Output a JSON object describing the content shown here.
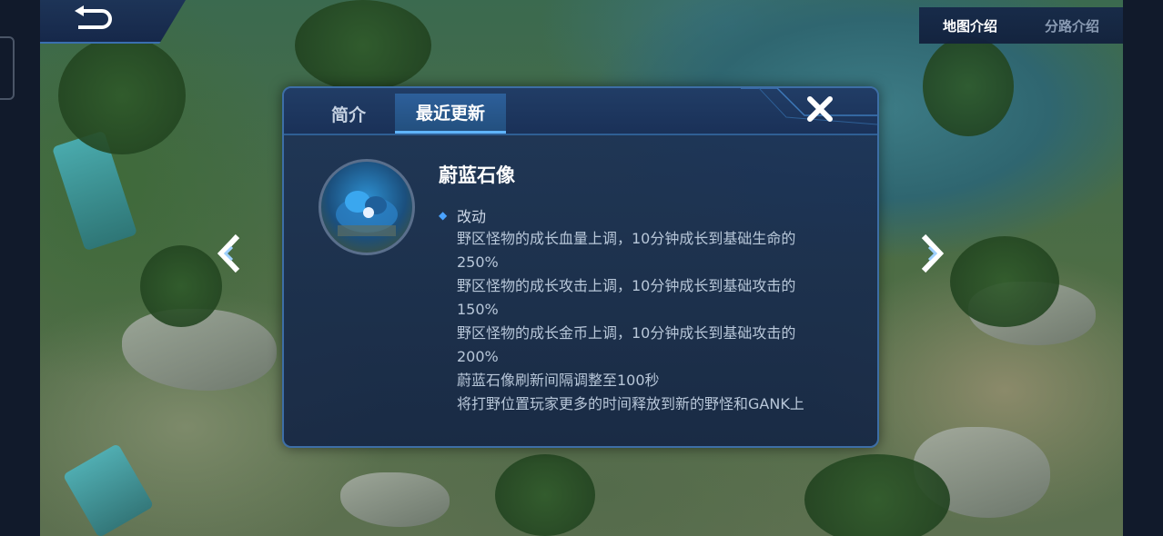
{
  "top_tabs": [
    {
      "label": "地图介绍",
      "active": true
    },
    {
      "label": "分路介绍",
      "active": false
    }
  ],
  "dialog": {
    "tabs": [
      {
        "label": "简介",
        "active": false
      },
      {
        "label": "最近更新",
        "active": true
      }
    ],
    "monster_name": "蔚蓝石像",
    "section_title": "改动",
    "changes": [
      "野区怪物的成长血量上调，10分钟成长到基础生命的",
      "250%",
      "野区怪物的成长攻击上调，10分钟成长到基础攻击的",
      "150%",
      "野区怪物的成长金币上调，10分钟成长到基础攻击的",
      "200%",
      "蔚蓝石像刷新间隔调整至100秒",
      "将打野位置玩家更多的时间释放到新的野怪和GANK上"
    ]
  },
  "icons": {
    "back": "back-arrow-icon",
    "close": "close-x-icon",
    "prev": "chevron-left-icon",
    "next": "chevron-right-icon",
    "bullet": "diamond-bullet-icon"
  },
  "colors": {
    "accent": "#5fb4ff",
    "dialog_bg": "#1e3458",
    "text_primary": "#ffffff",
    "text_secondary": "#b8c7d9"
  }
}
